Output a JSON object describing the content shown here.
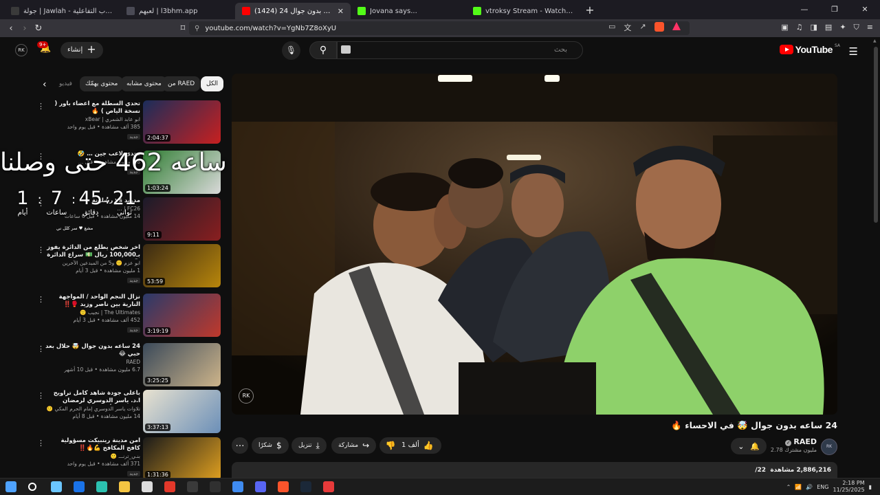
{
  "browser": {
    "tabs": [
      {
        "title": "جولة | Jawlah - منصة الألعاب التفاعلية",
        "icon": "jawlah-favicon",
        "color": "#3a3a3a",
        "active": false
      },
      {
        "title": "لعبهم | l3bhm.app",
        "icon": "l3bhm-favicon",
        "color": "#4a4a55",
        "active": false
      },
      {
        "title": "(1424) 24 ساعه بدون جوال",
        "icon": "youtube-favicon",
        "color": "#ff0000",
        "active": true
      },
      {
        "title": "Jovana says...",
        "icon": "kick-favicon",
        "color": "#53fc18",
        "active": false
      },
      {
        "title": "vtroksy Stream - Watch Live on Kick",
        "icon": "kick-favicon",
        "color": "#53fc18",
        "active": false
      }
    ],
    "url": "youtube.com/watch?v=YgNb7Z8oXyU",
    "close_glyph": "✕",
    "new_tab_glyph": "+",
    "window_controls": {
      "minimize": "—",
      "restore": "❐",
      "close": "✕"
    }
  },
  "header": {
    "logo_text": "YouTube",
    "region": "SA",
    "search_placeholder": "بحث",
    "create_label": "إنشاء",
    "notification_count": "9+",
    "avatar_text": "RK"
  },
  "chips": [
    {
      "label": "الكل",
      "active": true
    },
    {
      "label": "من RAED",
      "active": false
    },
    {
      "label": "محتوى مشابه",
      "active": false
    },
    {
      "label": "محتوى يهمّك",
      "active": false
    },
    {
      "label": "فيديو",
      "active": false
    }
  ],
  "related": [
    {
      "title": "تحدي السطلة مع اعضاء باور ( نسخة الياص ) 🔥",
      "channel": "ابو عابد الشمري | xBear",
      "stats": "385 ألف مشاهدة • قبل يوم واحد",
      "badge": "جديد",
      "duration": "2:04:37",
      "colors": [
        "#1a2d5a",
        "#c82020"
      ]
    },
    {
      "title": "تحدي لاعب جين … 🤣",
      "channel": "",
      "stats": "1.8 مليون مشاهدة • قبل …",
      "badge": "جديد",
      "duration": "1:03:24",
      "colors": [
        "#2f7d32",
        "#d9d9d9"
      ]
    },
    {
      "title": "مدريد vs رشلونة",
      "channel": "FC26 | …",
      "stats": "14 مليون مشاهدة • قبل 6 ساعات",
      "badge": "",
      "duration": "9:11",
      "colors": [
        "#1b1b2a",
        "#8a1f1f"
      ]
    },
    {
      "title": "اخر شخص يطلع من الدائرة يفوز بـ100,000 ريال 💵 سراع الدائرة 💀 …",
      "channel": "ابو عزم 🙂 و5 من المبدعين الآخرين",
      "stats": "1 مليون مشاهدة • قبل 3 أيام",
      "badge": "جديد",
      "duration": "53:59",
      "colors": [
        "#3a2a14",
        "#b8860b"
      ]
    },
    {
      "title": "نزال النجم الواحد / المواجهة النارية بين ناصر وزيد 🥊‼️",
      "channel": "The Ultimates | نجيب 🙂",
      "stats": "452 ألف مشاهدة • قبل 3 أيام",
      "badge": "جديد",
      "duration": "3:19:19",
      "colors": [
        "#2a3a6a",
        "#c0392b"
      ]
    },
    {
      "title": "24 ساعه بدون جوال 🤯 حلال بعد حبي 😂",
      "channel": "RAED",
      "stats": "6.7 مليون مشاهدة • قبل 10 أشهر",
      "badge": "",
      "duration": "3:25:25",
      "colors": [
        "#3b4a5a",
        "#cdb48a"
      ]
    },
    {
      "title": "باعلى جودة شاهد كامل تراويح ا.د. ياسر الدوسري لرمضان 1446هـ | أجمل التلاو…",
      "channel": "تلاوات ياسر الدوسري إمام الحرم المكي 🙂",
      "stats": "14 مليون مشاهدة • قبل 8 أيام",
      "badge": "",
      "duration": "3:37:13",
      "colors": [
        "#e8e2d0",
        "#6b8fb8"
      ]
    },
    {
      "title": "امن مدينة رينبيكت مسؤولية كافح المكافح 💪🔥‼️",
      "channel": "بنـي_ترنـــ 🙂",
      "stats": "371 ألف مشاهدة • قبل يوم واحد",
      "badge": "جديد",
      "duration": "1:31:36",
      "colors": [
        "#1a1a1a",
        "#e0a020"
      ]
    }
  ],
  "overlay": {
    "title": "ساعه 462 حتى وصلنا",
    "countdown": [
      {
        "value": "21",
        "label": "ثواني"
      },
      {
        "value": "45",
        "label": "دقائق"
      },
      {
        "value": "7",
        "label": "ساعات"
      },
      {
        "value": "1",
        "label": "أيام"
      }
    ],
    "footer": "مشغ ♥ سر كلل ني"
  },
  "video": {
    "title": "24 ساعه بدون جوال 🤯 في الاحساء 🔥",
    "watermark": "RK",
    "channel": {
      "name": "RAED",
      "subscribers": "2.78 مليون مشترك"
    },
    "like_count": "171 ألف",
    "share_label": "مشاركة",
    "download_label": "تنزيل",
    "thanks_label": "شكرًا",
    "views": "2,886,216 مشاهدة",
    "date": "22/"
  },
  "taskbar": {
    "time": "2:18 PM",
    "date": "11/25/2025",
    "lang": "ENG",
    "apps": [
      {
        "name": "windows-start-icon",
        "color": "#4fa3ff"
      },
      {
        "name": "search-icon",
        "color": "#ffffff"
      },
      {
        "name": "copilot-icon",
        "color": "#6bc6ff"
      },
      {
        "name": "outlook-icon",
        "color": "#1a73e8"
      },
      {
        "name": "edge-icon",
        "color": "#2cc1b0"
      },
      {
        "name": "file-explorer-icon",
        "color": "#f5c542"
      },
      {
        "name": "store-icon",
        "color": "#dcdcdc"
      },
      {
        "name": "office-icon",
        "color": "#e3382a"
      },
      {
        "name": "xbox-icon",
        "color": "#3a3a3a"
      },
      {
        "name": "obs-icon",
        "color": "#303030"
      },
      {
        "name": "chrome-icon",
        "color": "#3f8bf0"
      },
      {
        "name": "discord-icon",
        "color": "#5865f2"
      },
      {
        "name": "brave-icon",
        "color": "#fb542b"
      },
      {
        "name": "steam-icon",
        "color": "#1b2838"
      },
      {
        "name": "rockstar-icon",
        "color": "#e63a3a"
      }
    ]
  }
}
